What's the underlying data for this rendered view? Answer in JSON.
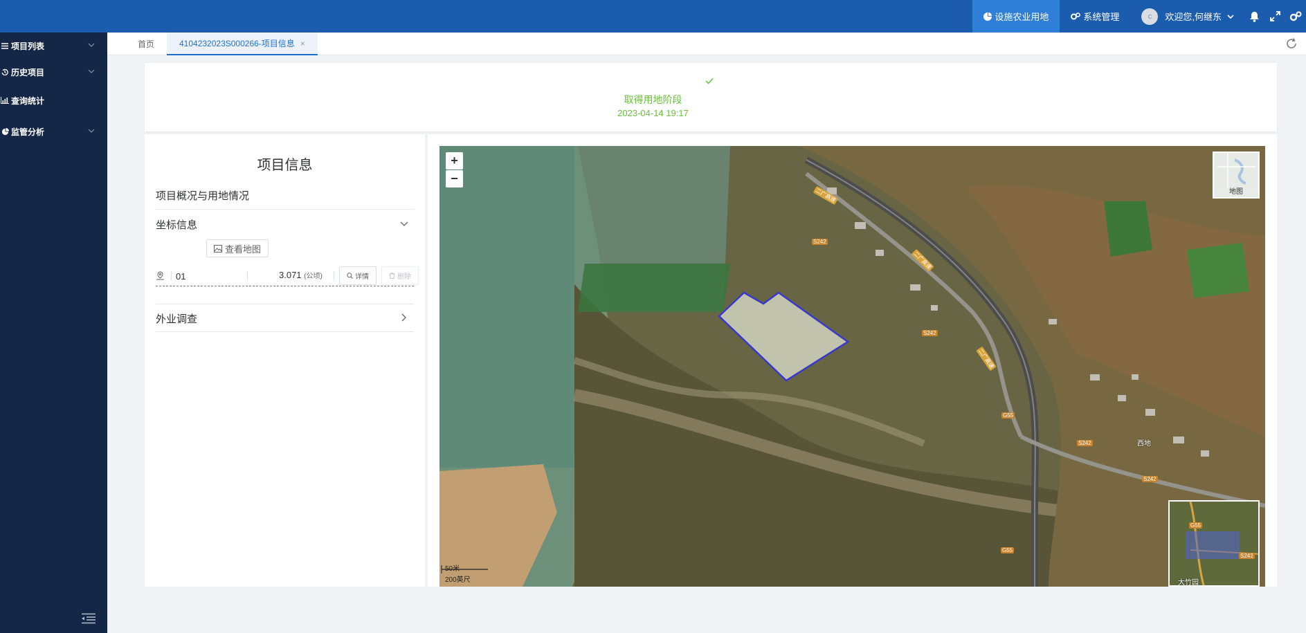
{
  "header": {
    "nav_active": "设施农业用地",
    "nav_system": "系统管理",
    "user_initial": "c",
    "welcome": "欢迎您,何继东"
  },
  "sidebar": {
    "items": [
      {
        "label": "项目列表"
      },
      {
        "label": "历史项目"
      },
      {
        "label": "查询统计"
      },
      {
        "label": "监管分析"
      }
    ]
  },
  "tabs": [
    {
      "label": "首页"
    },
    {
      "label": "4104232023S000266-项目信息",
      "close": "×"
    }
  ],
  "stage": {
    "name": "取得用地阶段",
    "time": "2023-04-14 19:17"
  },
  "info": {
    "title": "项目信息",
    "overview": "项目概况与用地情况",
    "coord_section": "坐标信息",
    "view_map": "查看地图",
    "parcels": [
      {
        "name": "01",
        "area": "3.071",
        "unit": "(公顷)",
        "detail": "详情",
        "delete": "删除"
      }
    ],
    "field_survey": "外业调查"
  },
  "map": {
    "zoom_in": "+",
    "zoom_out": "−",
    "basemap_label": "地图",
    "scale_top": "50米",
    "scale_bottom": "200英尺",
    "overview_label": "大竹园",
    "road_labels": [
      "S242",
      "S242",
      "S242",
      "S242",
      "G55",
      "G55",
      "二广高速",
      "二广高速",
      "二广高速",
      "G55",
      "S242"
    ],
    "village_label": "西地"
  },
  "colors": {
    "header_bg": "#1c5cae",
    "header_active": "#2f7ed8",
    "sidebar_bg": "#152746",
    "accent": "#1c6fd1",
    "success": "#67c23a",
    "parcel_stroke": "#3b3bd6"
  }
}
